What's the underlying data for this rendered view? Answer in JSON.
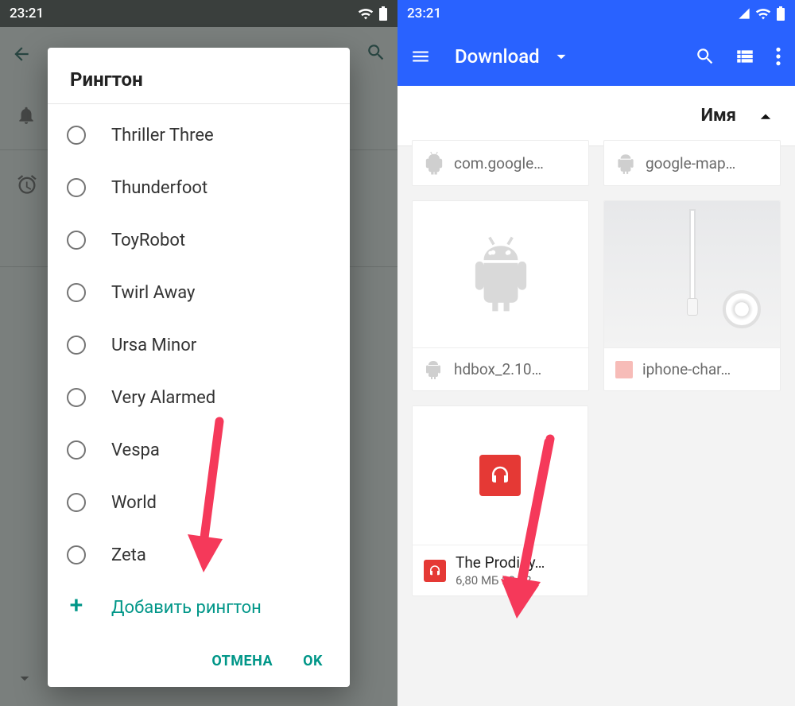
{
  "status_left": {
    "time": "23:21"
  },
  "status_right": {
    "time": "23:21"
  },
  "dialog": {
    "title": "Рингтон",
    "items": [
      "Thriller Three",
      "Thunderfoot",
      "ToyRobot",
      "Twirl Away",
      "Ursa Minor",
      "Very Alarmed",
      "Vespa",
      "World",
      "Zeta"
    ],
    "add_label": "Добавить рингтон",
    "cancel": "ОТМЕНА",
    "ok": "OK"
  },
  "filemanager": {
    "title": "Download",
    "sort_label": "Имя",
    "files": {
      "top_left": "com.google…",
      "top_right": "google-map…",
      "mid_left": "hdbox_2.10…",
      "mid_right": "iphone-char…",
      "bottom_name": "The Prodigy…",
      "bottom_meta": "6,80 МБ 23:02"
    }
  }
}
